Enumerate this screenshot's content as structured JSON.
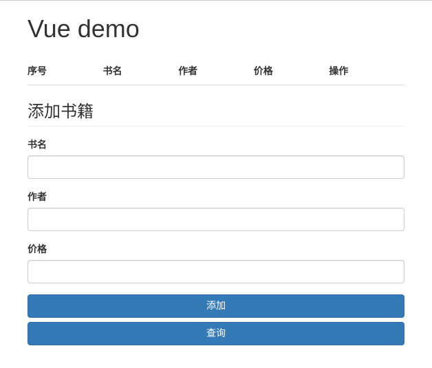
{
  "header": {
    "title": "Vue demo"
  },
  "table": {
    "columns": [
      "序号",
      "书名",
      "作者",
      "价格",
      "操作"
    ]
  },
  "form": {
    "title": "添加书籍",
    "fields": {
      "bookName": {
        "label": "书名",
        "value": ""
      },
      "author": {
        "label": "作者",
        "value": ""
      },
      "price": {
        "label": "价格",
        "value": ""
      }
    },
    "buttons": {
      "add": "添加",
      "search": "查询"
    }
  }
}
